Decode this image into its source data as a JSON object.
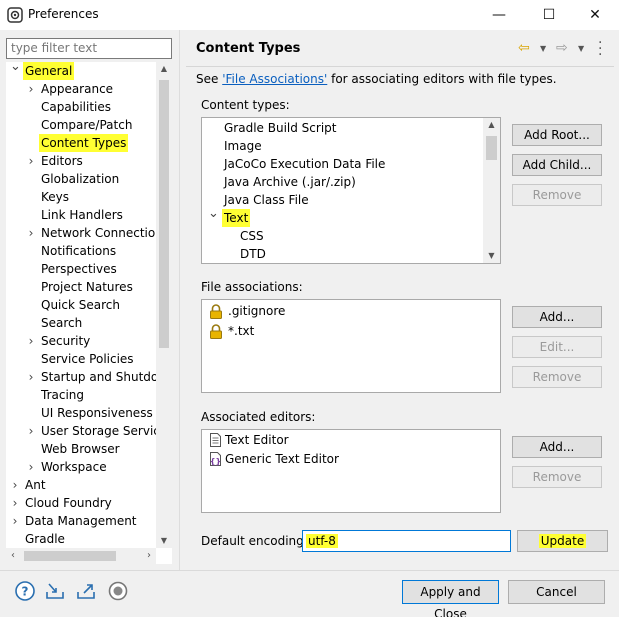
{
  "window": {
    "title": "Preferences",
    "minimize": "—",
    "maximize": "☐",
    "close": "✕"
  },
  "filter": {
    "placeholder": "type filter text"
  },
  "tree": {
    "items": [
      {
        "label": "General",
        "level": 0,
        "expander": "expanded",
        "highlight": true
      },
      {
        "label": "Appearance",
        "level": 1,
        "expander": "collapsed"
      },
      {
        "label": "Capabilities",
        "level": 1,
        "expander": ""
      },
      {
        "label": "Compare/Patch",
        "level": 1,
        "expander": ""
      },
      {
        "label": "Content Types",
        "level": 1,
        "expander": "",
        "highlight": true
      },
      {
        "label": "Editors",
        "level": 1,
        "expander": "collapsed"
      },
      {
        "label": "Globalization",
        "level": 1,
        "expander": ""
      },
      {
        "label": "Keys",
        "level": 1,
        "expander": ""
      },
      {
        "label": "Link Handlers",
        "level": 1,
        "expander": ""
      },
      {
        "label": "Network Connections",
        "level": 1,
        "expander": "collapsed"
      },
      {
        "label": "Notifications",
        "level": 1,
        "expander": ""
      },
      {
        "label": "Perspectives",
        "level": 1,
        "expander": ""
      },
      {
        "label": "Project Natures",
        "level": 1,
        "expander": ""
      },
      {
        "label": "Quick Search",
        "level": 1,
        "expander": ""
      },
      {
        "label": "Search",
        "level": 1,
        "expander": ""
      },
      {
        "label": "Security",
        "level": 1,
        "expander": "collapsed"
      },
      {
        "label": "Service Policies",
        "level": 1,
        "expander": ""
      },
      {
        "label": "Startup and Shutdown",
        "level": 1,
        "expander": "collapsed"
      },
      {
        "label": "Tracing",
        "level": 1,
        "expander": ""
      },
      {
        "label": "UI Responsiveness Monitoring",
        "level": 1,
        "expander": ""
      },
      {
        "label": "User Storage Service",
        "level": 1,
        "expander": "collapsed"
      },
      {
        "label": "Web Browser",
        "level": 1,
        "expander": ""
      },
      {
        "label": "Workspace",
        "level": 1,
        "expander": "collapsed"
      },
      {
        "label": "Ant",
        "level": 0,
        "expander": "collapsed"
      },
      {
        "label": "Cloud Foundry",
        "level": 0,
        "expander": "collapsed"
      },
      {
        "label": "Data Management",
        "level": 0,
        "expander": "collapsed"
      },
      {
        "label": "Gradle",
        "level": 0,
        "expander": ""
      }
    ]
  },
  "page": {
    "title": "Content Types",
    "see_prefix": "See ",
    "see_link": "'File Associations'",
    "see_suffix": " for associating editors with file types.",
    "content_types_label": "Content types:",
    "file_assoc_label": "File associations:",
    "assoc_editors_label": "Associated editors:",
    "encoding_label": "Default encoding:",
    "encoding_value": "utf-8"
  },
  "content_types": [
    {
      "label": "Gradle Build Script",
      "level": 1,
      "expander": ""
    },
    {
      "label": "Image",
      "level": 1,
      "expander": ""
    },
    {
      "label": "JaCoCo Execution Data File",
      "level": 1,
      "expander": ""
    },
    {
      "label": "Java Archive (.jar/.zip)",
      "level": 1,
      "expander": ""
    },
    {
      "label": "Java Class File",
      "level": 1,
      "expander": ""
    },
    {
      "label": "Text",
      "level": 1,
      "expander": "expanded",
      "highlight": true
    },
    {
      "label": "CSS",
      "level": 2,
      "expander": ""
    },
    {
      "label": "DTD",
      "level": 2,
      "expander": ""
    }
  ],
  "file_associations": [
    ".gitignore",
    "*.txt"
  ],
  "associated_editors": [
    "Text Editor",
    "Generic Text Editor"
  ],
  "buttons": {
    "add_root": "Add Root...",
    "add_child": "Add Child...",
    "remove": "Remove",
    "add": "Add...",
    "edit": "Edit...",
    "update": "Update",
    "apply_close": "Apply and Close",
    "cancel": "Cancel"
  },
  "colors": {
    "highlight": "#ffff33",
    "link": "#0a5fbf",
    "focus": "#0078d7"
  }
}
